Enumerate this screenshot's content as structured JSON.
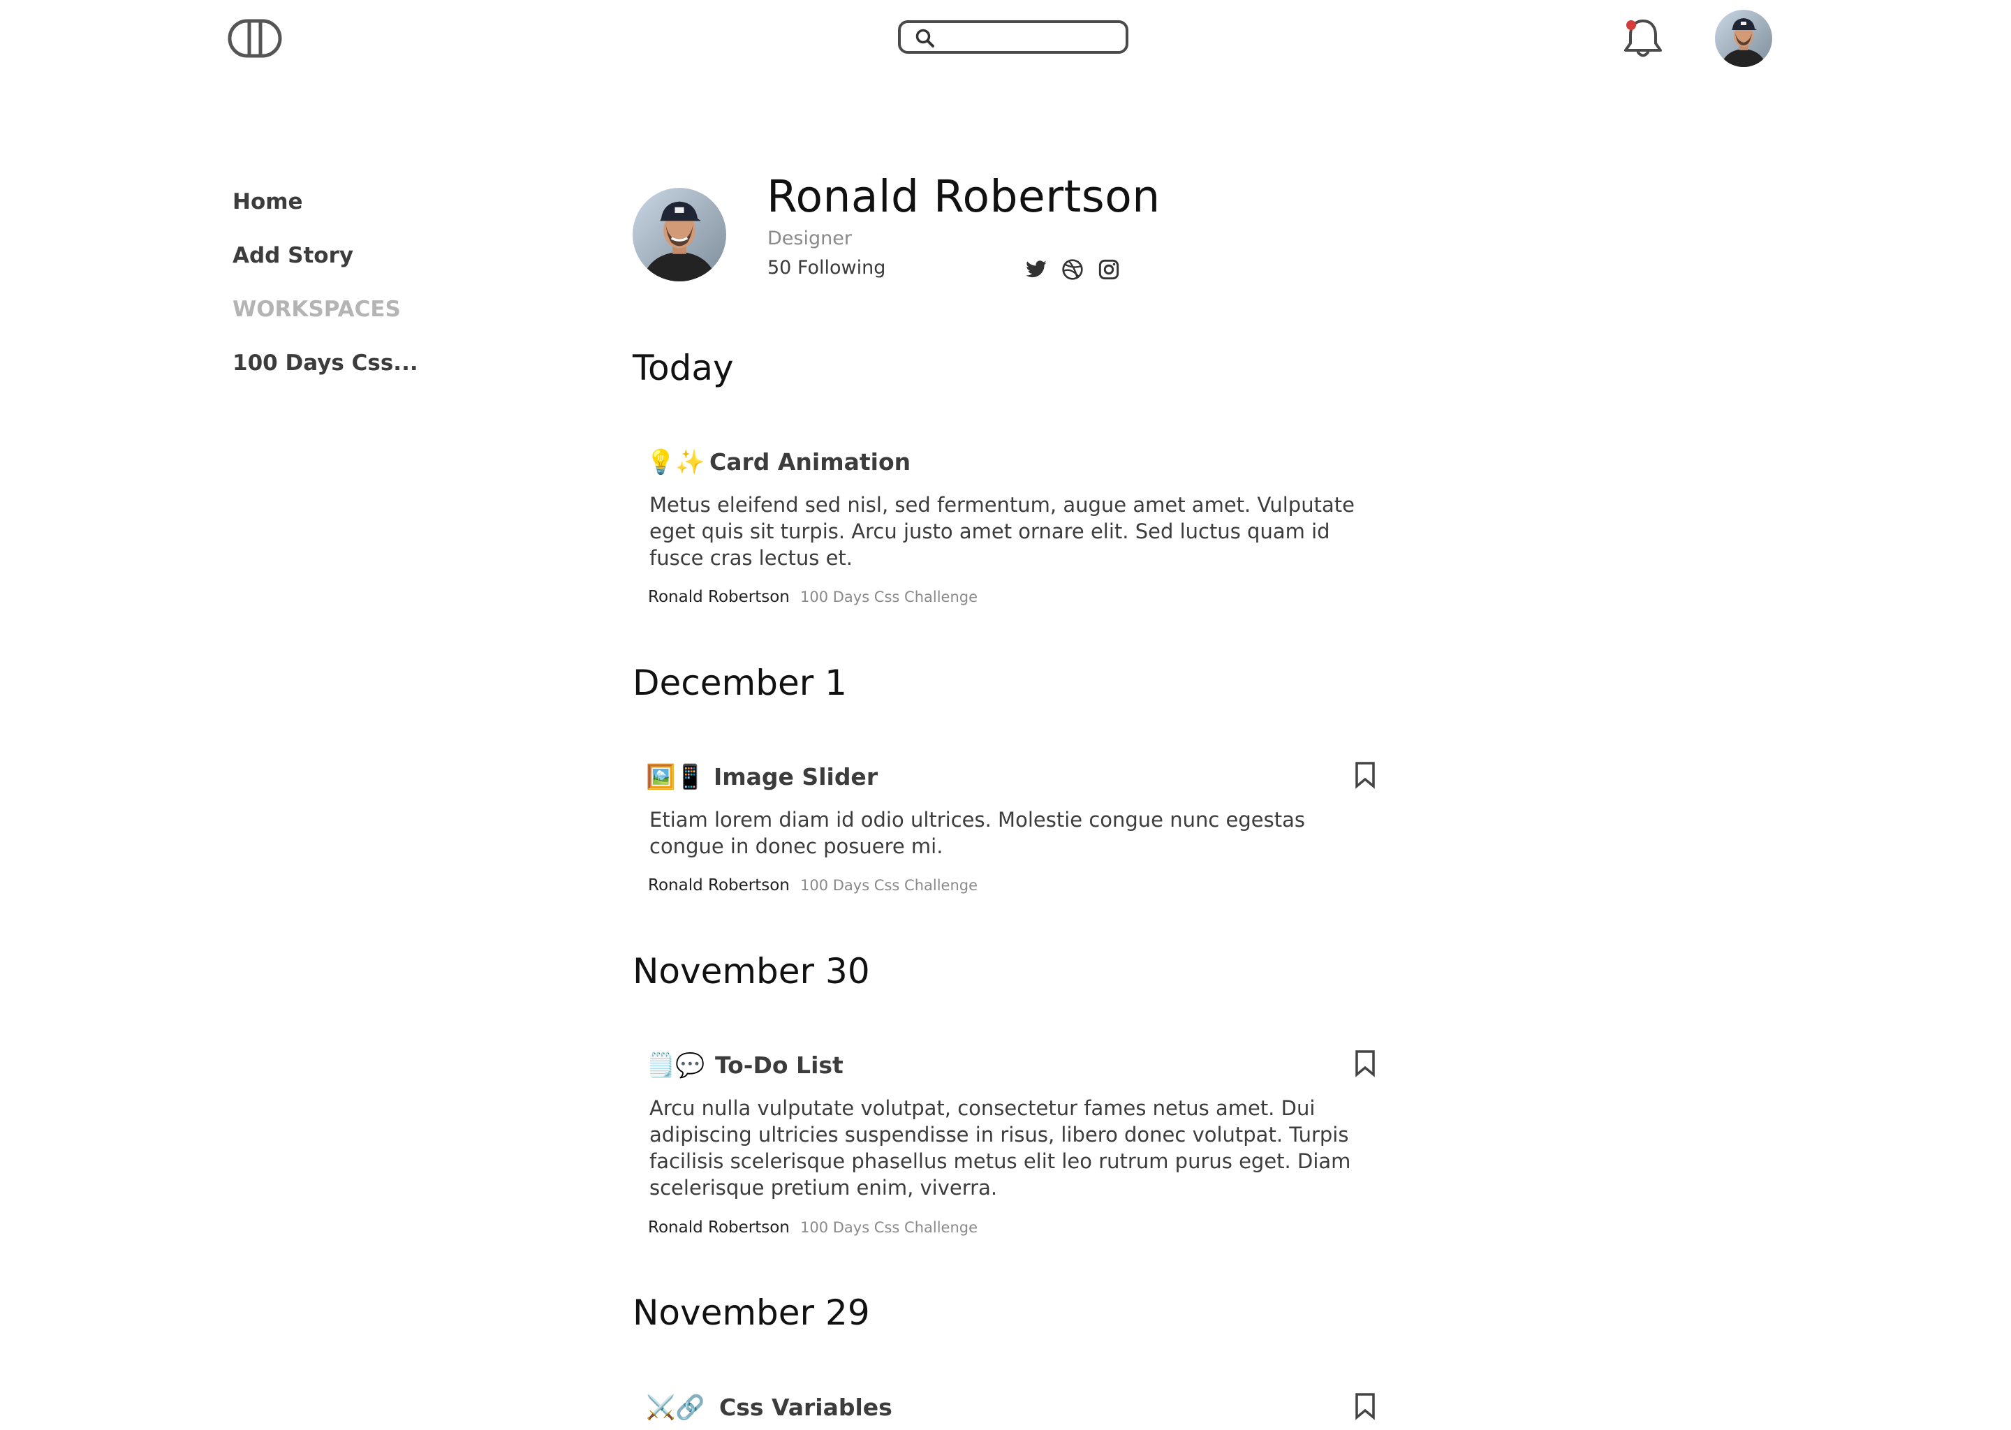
{
  "header": {
    "logo_icon": "pill-logo-icon",
    "search": {
      "placeholder": "",
      "value": "",
      "icon": "search-icon"
    },
    "notification_icon": "bell-icon",
    "notification_dot_color": "#d63b3b"
  },
  "sidebar": {
    "items": [
      {
        "label": "Home"
      },
      {
        "label": "Add Story"
      },
      {
        "label": "WORKSPACES"
      },
      {
        "label": "100 Days Css..."
      }
    ]
  },
  "profile": {
    "name": "Ronald Robertson",
    "role": "Designer",
    "following": "50 Following",
    "social_icons": [
      "twitter-icon",
      "dribbble-icon",
      "instagram-icon"
    ]
  },
  "feed": {
    "groups": [
      {
        "date": "Today",
        "stories": [
          {
            "emoji": "💡✨",
            "title": "Card Animation",
            "body": "Metus eleifend sed nisl, sed fermentum, augue amet amet. Vulputate eget quis sit turpis. Arcu justo amet ornare elit. Sed luctus quam id fusce cras lectus et.",
            "author": "Ronald Robertson",
            "workspace": "100 Days Css Challenge"
          }
        ]
      },
      {
        "date": "December 1",
        "stories": [
          {
            "emoji": "🖼️📱",
            "title": "Image Slider",
            "body": "Etiam lorem diam id odio ultrices. Molestie congue nunc egestas congue in donec posuere mi.",
            "author": "Ronald Robertson",
            "workspace": "100 Days Css Challenge"
          }
        ]
      },
      {
        "date": "November 30",
        "stories": [
          {
            "emoji": "🗒️💬",
            "title": "To-Do List",
            "body": "Arcu nulla vulputate volutpat, consectetur fames netus amet. Dui adipiscing ultricies suspendisse in risus, libero donec volutpat. Turpis facilisis scelerisque phasellus metus elit leo rutrum purus eget. Diam scelerisque pretium enim, viverra.",
            "author": "Ronald Robertson",
            "workspace": "100 Days Css Challenge"
          }
        ]
      },
      {
        "date": "November 29",
        "stories": [
          {
            "emoji": "⚔️🔗",
            "title": "Css Variables"
          }
        ]
      }
    ]
  },
  "colors": {
    "text": "#3c3c3c",
    "heading": "#111111",
    "muted": "#8a8a8a",
    "section_label": "#b4b4b4"
  }
}
